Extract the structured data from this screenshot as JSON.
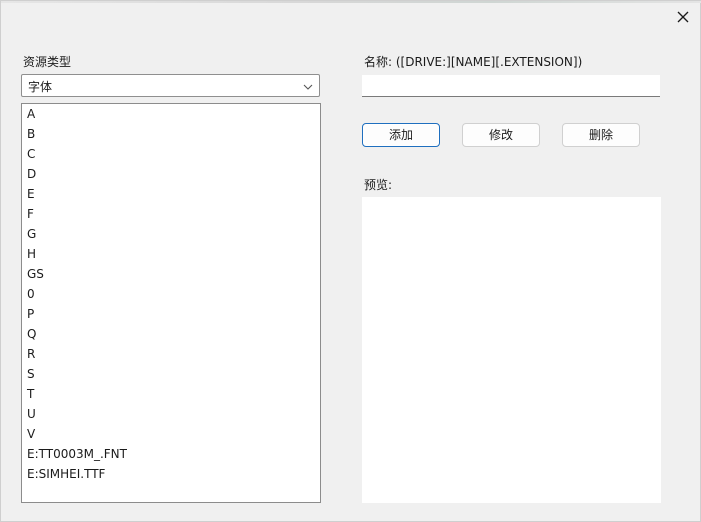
{
  "window": {
    "close_icon": "close-icon"
  },
  "resource_type": {
    "label": "资源类型",
    "selected": "字体",
    "arrow_icon": "chevron-down-icon"
  },
  "resource_list": {
    "items": [
      "A",
      "B",
      "C",
      "D",
      "E",
      "F",
      "G",
      "H",
      "GS",
      "0",
      "P",
      "Q",
      "R",
      "S",
      "T",
      "U",
      "V",
      "E:TT0003M_.FNT",
      "E:SIMHEI.TTF"
    ]
  },
  "name_field": {
    "label": "名称:  ([DRIVE:][NAME][.EXTENSION])",
    "value": "",
    "placeholder": ""
  },
  "buttons": {
    "add": "添加",
    "modify": "修改",
    "delete": "删除"
  },
  "preview": {
    "label": "预览:"
  },
  "colors": {
    "dialog_bg": "#f0f0f0",
    "primary_border": "#1f6fbf"
  }
}
